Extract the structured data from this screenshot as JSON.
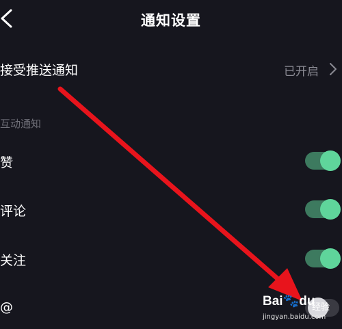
{
  "header": {
    "title": "通知设置",
    "back_icon": "chevron-left-icon"
  },
  "push": {
    "label": "接受推送通知",
    "status": "已开启",
    "chevron_icon": "chevron-right-icon"
  },
  "interactions": {
    "section_label": "互动通知",
    "items": [
      {
        "label": "赞",
        "enabled": true
      },
      {
        "label": "评论",
        "enabled": true
      },
      {
        "label": "关注",
        "enabled": true
      },
      {
        "label": "@",
        "enabled": false
      }
    ]
  },
  "colors": {
    "background": "#16161e",
    "toggle_on_track": "#3d7a5f",
    "toggle_on_knob": "#5fd59b",
    "toggle_off_track": "#3a3a42",
    "annotation_arrow": "#e8141c"
  },
  "watermark": {
    "logo": "Bai",
    "logo_suffix": "du",
    "brand": "经验",
    "url": "jingyan.baidu.com"
  }
}
